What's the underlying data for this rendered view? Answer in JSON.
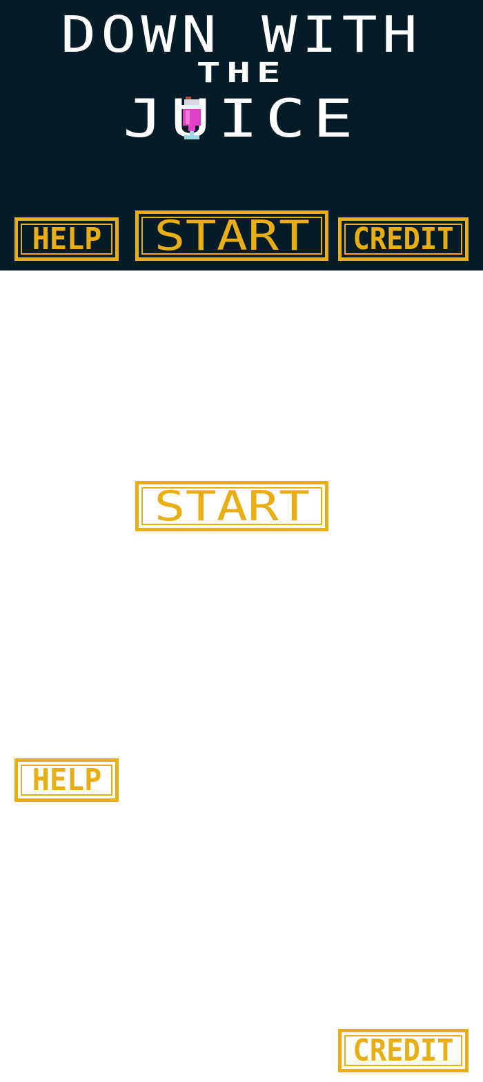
{
  "title": {
    "line1": "DOWN WITH",
    "line2": "THE",
    "line3": "JUICE"
  },
  "menu": {
    "help_label": "HELP",
    "start_label": "START",
    "credit_label": "CREDIT"
  },
  "standalone_buttons": {
    "start_label": "START",
    "help_label": "HELP",
    "credit_label": "CREDIT"
  },
  "colors": {
    "background": "#041b28",
    "title_text": "#ffffff",
    "button_accent": "#e8ae14",
    "juice": "#e040c8"
  },
  "icons": {
    "juice_glass": "milkshake-glass-icon"
  }
}
